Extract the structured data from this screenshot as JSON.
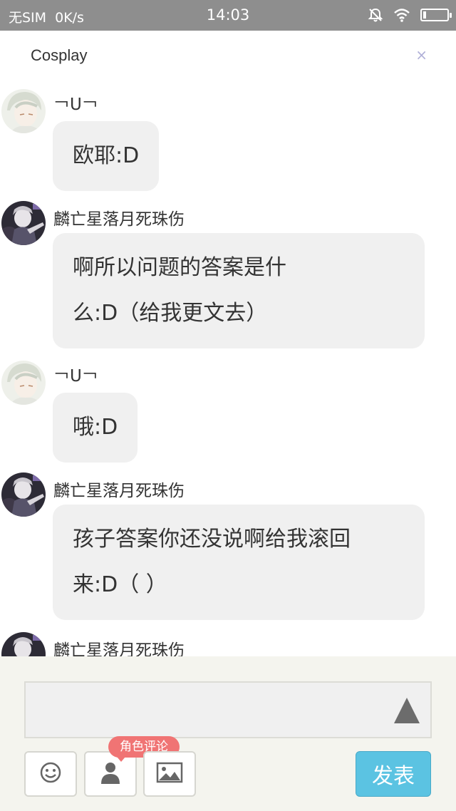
{
  "status_bar": {
    "carrier": "无SIM",
    "speed": "0K/s",
    "time": "14:03",
    "icons": [
      "mute-bell-icon",
      "wifi-icon",
      "battery-icon"
    ]
  },
  "header": {
    "title": "Cosplay",
    "close_label": "×"
  },
  "messages": [
    {
      "sender": "￢U￢",
      "avatar": "pale-character-avatar",
      "lines": [
        "欧耶:D"
      ]
    },
    {
      "sender": "麟亡星落月死珠伤",
      "avatar": "dark-character-avatar",
      "lines": [
        "啊所以问题的答案是什",
        "么:D（给我更文去）"
      ]
    },
    {
      "sender": "￢U￢",
      "avatar": "pale-character-avatar",
      "lines": [
        "哦:D"
      ]
    },
    {
      "sender": "麟亡星落月死珠伤",
      "avatar": "dark-character-avatar",
      "lines": [
        "孩子答案你还没说啊给我滚回",
        "来:D（ ）"
      ]
    },
    {
      "sender": "麟亡星落月死珠伤",
      "avatar": "dark-character-avatar",
      "lines": []
    }
  ],
  "composer": {
    "input_value": "",
    "role_comment_tag": "角色评论",
    "publish_label": "发表",
    "tools": [
      "emoji-icon",
      "person-icon",
      "image-icon"
    ]
  },
  "colors": {
    "status_bar": "#8e8e8e",
    "bubble": "#f0f0f0",
    "composer_bg": "#f4f4ee",
    "publish": "#5bc3e2",
    "tag": "#f07474"
  }
}
